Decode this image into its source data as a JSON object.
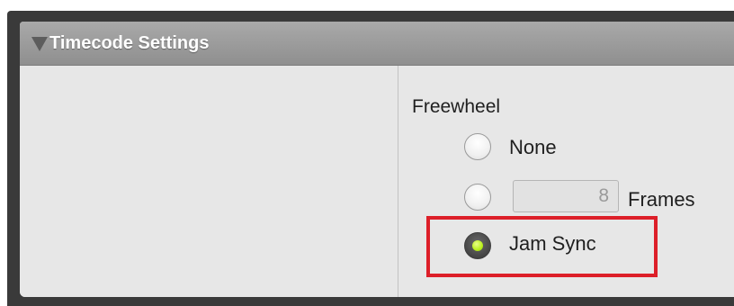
{
  "panel": {
    "title": "Timecode Settings",
    "collapse_icon": "triangle-down-icon"
  },
  "freewheel": {
    "label": "Freewheel",
    "options": [
      {
        "label": "None",
        "selected": false
      },
      {
        "value": "8",
        "unit_label": "Frames",
        "selected": false
      },
      {
        "label": "Jam Sync",
        "selected": true
      }
    ]
  },
  "colors": {
    "selected_indicator": "#b9ef1c",
    "highlight_box": "#dd1f29",
    "header": "#9c9c9c",
    "panel_bg": "#e7e7e7"
  }
}
